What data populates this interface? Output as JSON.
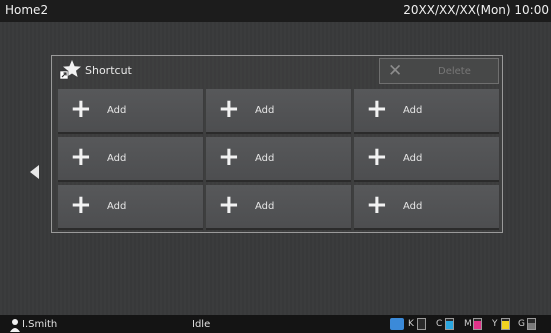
{
  "header": {
    "title": "Home2",
    "datetime": "20XX/XX/XX(Mon) 10:00"
  },
  "panel": {
    "title": "Shortcut",
    "delete_label": "Delete"
  },
  "tiles": [
    {
      "label": "Add"
    },
    {
      "label": "Add"
    },
    {
      "label": "Add"
    },
    {
      "label": "Add"
    },
    {
      "label": "Add"
    },
    {
      "label": "Add"
    },
    {
      "label": "Add"
    },
    {
      "label": "Add"
    },
    {
      "label": "Add"
    }
  ],
  "status": {
    "user": "I.Smith",
    "state": "Idle",
    "toner": [
      {
        "name": "K",
        "level": 0,
        "color": "#222222"
      },
      {
        "name": "C",
        "level": 0.8,
        "color": "#2aa7e0"
      },
      {
        "name": "M",
        "level": 0.8,
        "color": "#e0338a"
      },
      {
        "name": "Y",
        "level": 0.8,
        "color": "#f2d21f"
      },
      {
        "name": "G",
        "level": 0.6,
        "color": "#7a7a7a"
      }
    ]
  },
  "icons": {
    "nav": "chevron-left-icon",
    "shortcut": "star-shortcut-icon",
    "delete": "close-icon",
    "add": "plus-icon",
    "user": "user-icon",
    "refresh": "refresh-icon"
  }
}
